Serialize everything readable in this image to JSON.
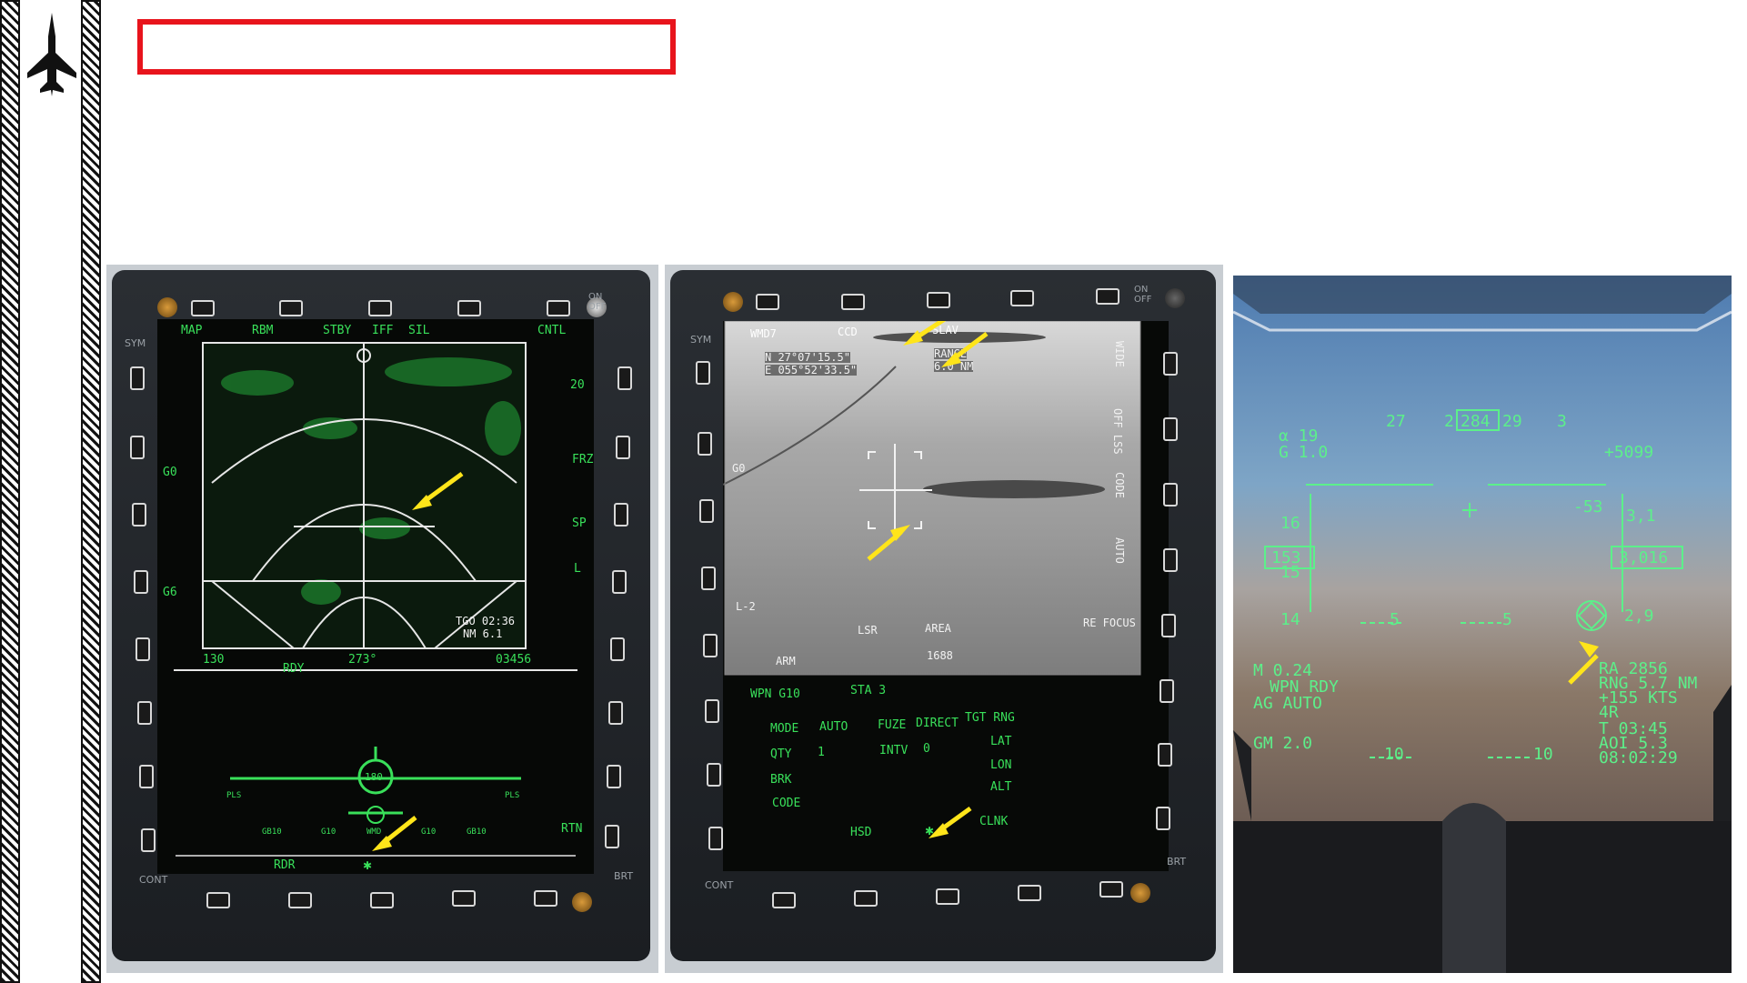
{
  "slide": {
    "title_box_text": ""
  },
  "radar_mfd": {
    "top_labels": [
      "MAP",
      "RBM",
      "STBY",
      "IFF",
      "SIL",
      "CNTL"
    ],
    "left_labels": [
      "G0",
      "G6"
    ],
    "right_labels": [
      "20",
      "FRZ",
      "SP",
      "L"
    ],
    "tgo": "TGO 02:36",
    "nm": "NM  6.1",
    "bottom_left": "130",
    "bottom_center": "273°",
    "bottom_right": "03456",
    "status": "RDY",
    "heading_box": "180",
    "stores": [
      "PLS",
      "GB10",
      "G10",
      "WMD",
      "G10",
      "GB10",
      "PLS"
    ],
    "bottom_tab": "RDR",
    "rtn": "RTN",
    "sym": "SYM",
    "cont": "CONT",
    "brt": "BRT",
    "on_off": "ON\nOFF"
  },
  "flir_mfd": {
    "top_labels": [
      "WMD7",
      "CCD",
      "SLAV"
    ],
    "coords_n": "N  27°07'15.5\"",
    "coords_e": "E 055°52'33.5\"",
    "range_label": "RANGE",
    "range_value": "6.0 NM",
    "side_right": [
      "WIDE",
      "OFF LSS",
      "CODE",
      "AUTO",
      "RE FOCUS"
    ],
    "side_left": [
      "G0",
      "L-2"
    ],
    "bottom_labels": [
      "LSR",
      "AREA"
    ],
    "arm": "ARM",
    "code_value": "1688",
    "wpn": "WPN  G10",
    "sta": "STA  3",
    "mode": "MODE",
    "mode_value": "AUTO",
    "fuze": "FUZE",
    "fuze_value": "DIRECT",
    "tgt_rng": "TGT RNG",
    "qty": "QTY",
    "qty_value": "1",
    "intv": "INTV",
    "intv_value": "0",
    "lat": "LAT",
    "lon": "LON",
    "alt": "ALT",
    "brk": "BRK",
    "code": "CODE",
    "hsd": "HSD",
    "clnk": "CLNK",
    "sym": "SYM",
    "cont": "CONT",
    "brt": "BRT",
    "on_off": "ON\nOFF"
  },
  "hud": {
    "alpha": "α   19",
    "g": "G  1.0",
    "heading_ticks": [
      "27",
      "2",
      "284",
      "29",
      "3"
    ],
    "altitude_top": "+5099",
    "speed_ticks": [
      "16",
      "15",
      "14"
    ],
    "speed_box": "153",
    "alt_box": "3,016",
    "pitch_right": "-53",
    "alt_tick_1": "3,1",
    "alt_tick_2": "2,9",
    "ladder_5_left": "5",
    "ladder_5_right": "5",
    "ladder_10_left": "10",
    "ladder_10_right": "10",
    "mach": "M 0.24",
    "wpn_rdy": "WPN RDY",
    "ag_auto": "AG  AUTO",
    "gm": "GM 2.0",
    "ra": "RA  2856",
    "rng": "RNG 5.7 NM",
    "kts": "+155 KTS",
    "ar": "4R",
    "t": "T 03:45",
    "aoi": "AOI 5.3",
    "clock": "08:02:29"
  },
  "colors": {
    "mfd_green": "#39e05a",
    "arrow_yellow": "#ffe51a",
    "title_red": "#e8141c"
  }
}
